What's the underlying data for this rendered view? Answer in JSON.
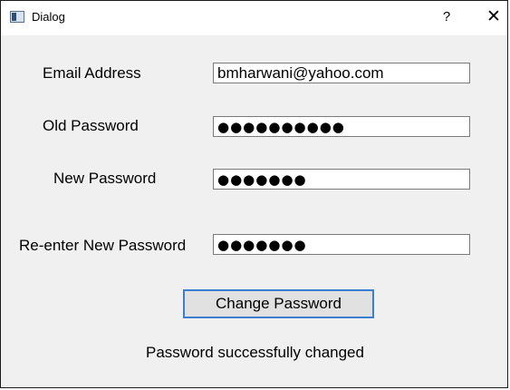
{
  "window": {
    "title": "Dialog",
    "help_glyph": "?",
    "close_glyph": "✕"
  },
  "form": {
    "email_label": "Email Address",
    "email_value": "bmharwani@yahoo.com",
    "old_password_label": "Old Password",
    "old_password_value": "●●●●●●●●●●",
    "new_password_label": "New Password",
    "new_password_value": "●●●●●●●",
    "reenter_password_label": "Re-enter New Password",
    "reenter_password_value": "●●●●●●●"
  },
  "actions": {
    "change_password_label": "Change Password"
  },
  "status": {
    "message": "Password successfully changed"
  }
}
